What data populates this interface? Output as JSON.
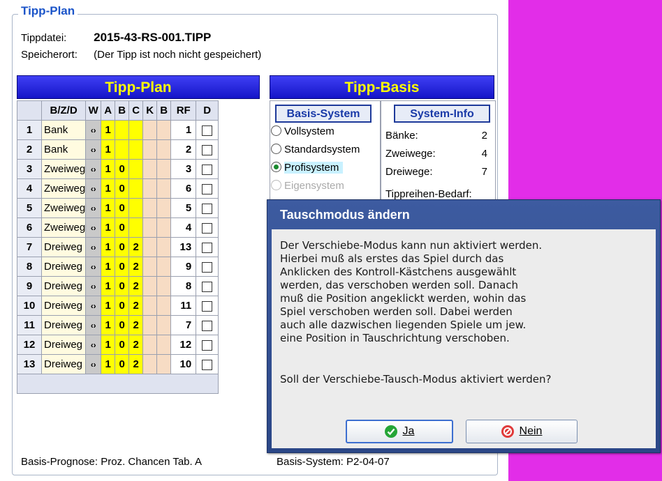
{
  "group": {
    "title": "Tipp-Plan",
    "tippdatei_label": "Tippdatei:",
    "tippdatei_value": "2015-43-RS-001.TIPP",
    "speicherort_label": "Speicherort:",
    "speicherort_value": "(Der Tipp ist noch nicht gespeichert)"
  },
  "plan": {
    "header": "Tipp-Plan",
    "columns": [
      "B/Z/D",
      "W",
      "A",
      "B",
      "C",
      "K",
      "B",
      "RF",
      "D"
    ],
    "rows": [
      {
        "n": "1",
        "bzd": "Bank",
        "w": "‹›",
        "a": "1",
        "b": "",
        "c": "",
        "rf": "1"
      },
      {
        "n": "2",
        "bzd": "Bank",
        "w": "‹›",
        "a": "1",
        "b": "",
        "c": "",
        "rf": "2"
      },
      {
        "n": "3",
        "bzd": "Zweiweg",
        "w": "‹›",
        "a": "1",
        "b": "0",
        "c": "",
        "rf": "3"
      },
      {
        "n": "4",
        "bzd": "Zweiweg",
        "w": "‹›",
        "a": "1",
        "b": "0",
        "c": "",
        "rf": "6"
      },
      {
        "n": "5",
        "bzd": "Zweiweg",
        "w": "‹›",
        "a": "1",
        "b": "0",
        "c": "",
        "rf": "5"
      },
      {
        "n": "6",
        "bzd": "Zweiweg",
        "w": "‹›",
        "a": "1",
        "b": "0",
        "c": "",
        "rf": "4"
      },
      {
        "n": "7",
        "bzd": "Dreiweg",
        "w": "‹›",
        "a": "1",
        "b": "0",
        "c": "2",
        "rf": "13"
      },
      {
        "n": "8",
        "bzd": "Dreiweg",
        "w": "‹›",
        "a": "1",
        "b": "0",
        "c": "2",
        "rf": "9"
      },
      {
        "n": "9",
        "bzd": "Dreiweg",
        "w": "‹›",
        "a": "1",
        "b": "0",
        "c": "2",
        "rf": "8"
      },
      {
        "n": "10",
        "bzd": "Dreiweg",
        "w": "‹›",
        "a": "1",
        "b": "0",
        "c": "2",
        "rf": "11"
      },
      {
        "n": "11",
        "bzd": "Dreiweg",
        "w": "‹›",
        "a": "1",
        "b": "0",
        "c": "2",
        "rf": "7"
      },
      {
        "n": "12",
        "bzd": "Dreiweg",
        "w": "‹›",
        "a": "1",
        "b": "0",
        "c": "2",
        "rf": "12"
      },
      {
        "n": "13",
        "bzd": "Dreiweg",
        "w": "‹›",
        "a": "1",
        "b": "0",
        "c": "2",
        "rf": "10"
      }
    ]
  },
  "basis": {
    "header": "Tipp-Basis",
    "system_header": "Basis-System",
    "info_header": "System-Info",
    "options": [
      {
        "label": "Vollsystem",
        "selected": false,
        "disabled": false
      },
      {
        "label": "Standardsystem",
        "selected": false,
        "disabled": false
      },
      {
        "label": "Profisystem",
        "selected": true,
        "disabled": false
      },
      {
        "label": "Eigensystem",
        "selected": false,
        "disabled": true
      }
    ],
    "info": [
      {
        "label": "Bänke:",
        "value": "2"
      },
      {
        "label": "Zweiwege:",
        "value": "4"
      },
      {
        "label": "Dreiwege:",
        "value": "7"
      }
    ],
    "bedarf_label": "Tippreihen-Bedarf:"
  },
  "status": {
    "prognose": "Basis-Prognose: Proz. Chancen Tab. A",
    "system": "Basis-System: P2-04-07"
  },
  "dialog": {
    "title": "Tauschmodus ändern",
    "message": "Der Verschiebe-Modus kann nun aktiviert werden.\nHierbei muß als erstes das Spiel durch das\nAnklicken des Kontroll-Kästchens ausgewählt\nwerden, das verschoben werden soll. Danach\nmuß die Position angeklickt werden, wohin das\nSpiel verschoben werden soll. Dabei werden\nauch alle dazwischen liegenden Spiele um jew.\neine Position in Tauschrichtung verschoben.",
    "question": "Soll der Verschiebe-Tausch-Modus aktiviert werden?",
    "yes_label": "Ja",
    "no_label": "Nein"
  },
  "colors": {
    "accent": "#1c55c9",
    "header_bg": "#2020d8",
    "header_fg": "#ffff00",
    "magenta": "#e22de8"
  }
}
